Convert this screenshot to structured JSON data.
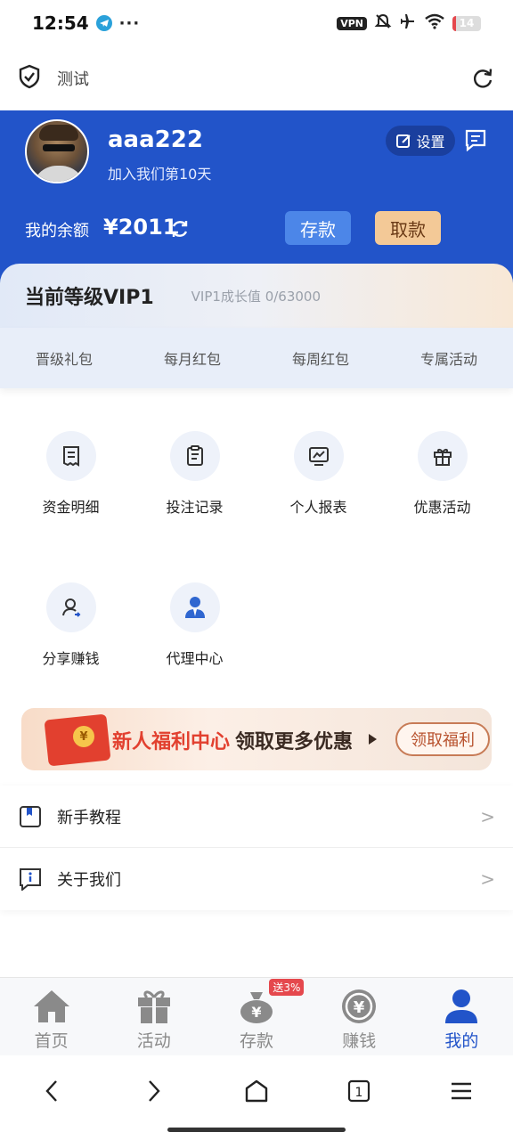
{
  "status_bar": {
    "time": "12:54",
    "dots": "···",
    "vpn": "VPN",
    "battery": "14",
    "battery_level": 0.14,
    "battery_color": "#e5484d",
    "icons": [
      "telegram-icon",
      "mute-icon",
      "airplane-icon",
      "wifi-icon",
      "battery-icon"
    ]
  },
  "header": {
    "title": "测试",
    "icons": [
      "shield-check-icon",
      "refresh-icon"
    ]
  },
  "profile": {
    "username": "aaa222",
    "join_text": "加入我们第10天",
    "settings_label": "设置",
    "balance_label": "我的余额",
    "balance_value": "¥2011",
    "deposit_label": "存款",
    "withdraw_label": "取款",
    "accent": "#2254C9"
  },
  "vip": {
    "title": "当前等级VIP1",
    "progress": "VIP1成长值 0/63000"
  },
  "perks": [
    "晋级礼包",
    "每月红包",
    "每周红包",
    "专属活动"
  ],
  "grid": [
    {
      "label": "资金明细",
      "icon": "receipt-icon"
    },
    {
      "label": "投注记录",
      "icon": "clipboard-icon"
    },
    {
      "label": "个人报表",
      "icon": "chart-monitor-icon"
    },
    {
      "label": "优惠活动",
      "icon": "gift-icon"
    },
    {
      "label": "分享赚钱",
      "icon": "user-share-icon"
    },
    {
      "label": "代理中心",
      "icon": "agent-icon"
    }
  ],
  "banner": {
    "text_highlight": "新人福利中心",
    "text_rest": "领取更多优惠",
    "coin": "¥",
    "button": "领取福利"
  },
  "list": [
    {
      "label": "新手教程",
      "icon": "bookmark-icon",
      "arrow": ">"
    },
    {
      "label": "关于我们",
      "icon": "info-icon",
      "arrow": ">"
    }
  ],
  "tabs": [
    {
      "label": "首页",
      "icon": "home-icon",
      "active": false
    },
    {
      "label": "活动",
      "icon": "gift-box-icon",
      "active": false
    },
    {
      "label": "存款",
      "icon": "money-bag-icon",
      "active": false,
      "badge": "送3%"
    },
    {
      "label": "赚钱",
      "icon": "yen-coin-icon",
      "active": false
    },
    {
      "label": "我的",
      "icon": "user-icon",
      "active": true
    }
  ],
  "browser": {
    "tab_count": "1",
    "icons": [
      "back-icon",
      "forward-icon",
      "home-icon",
      "tabs-icon",
      "menu-icon"
    ]
  }
}
